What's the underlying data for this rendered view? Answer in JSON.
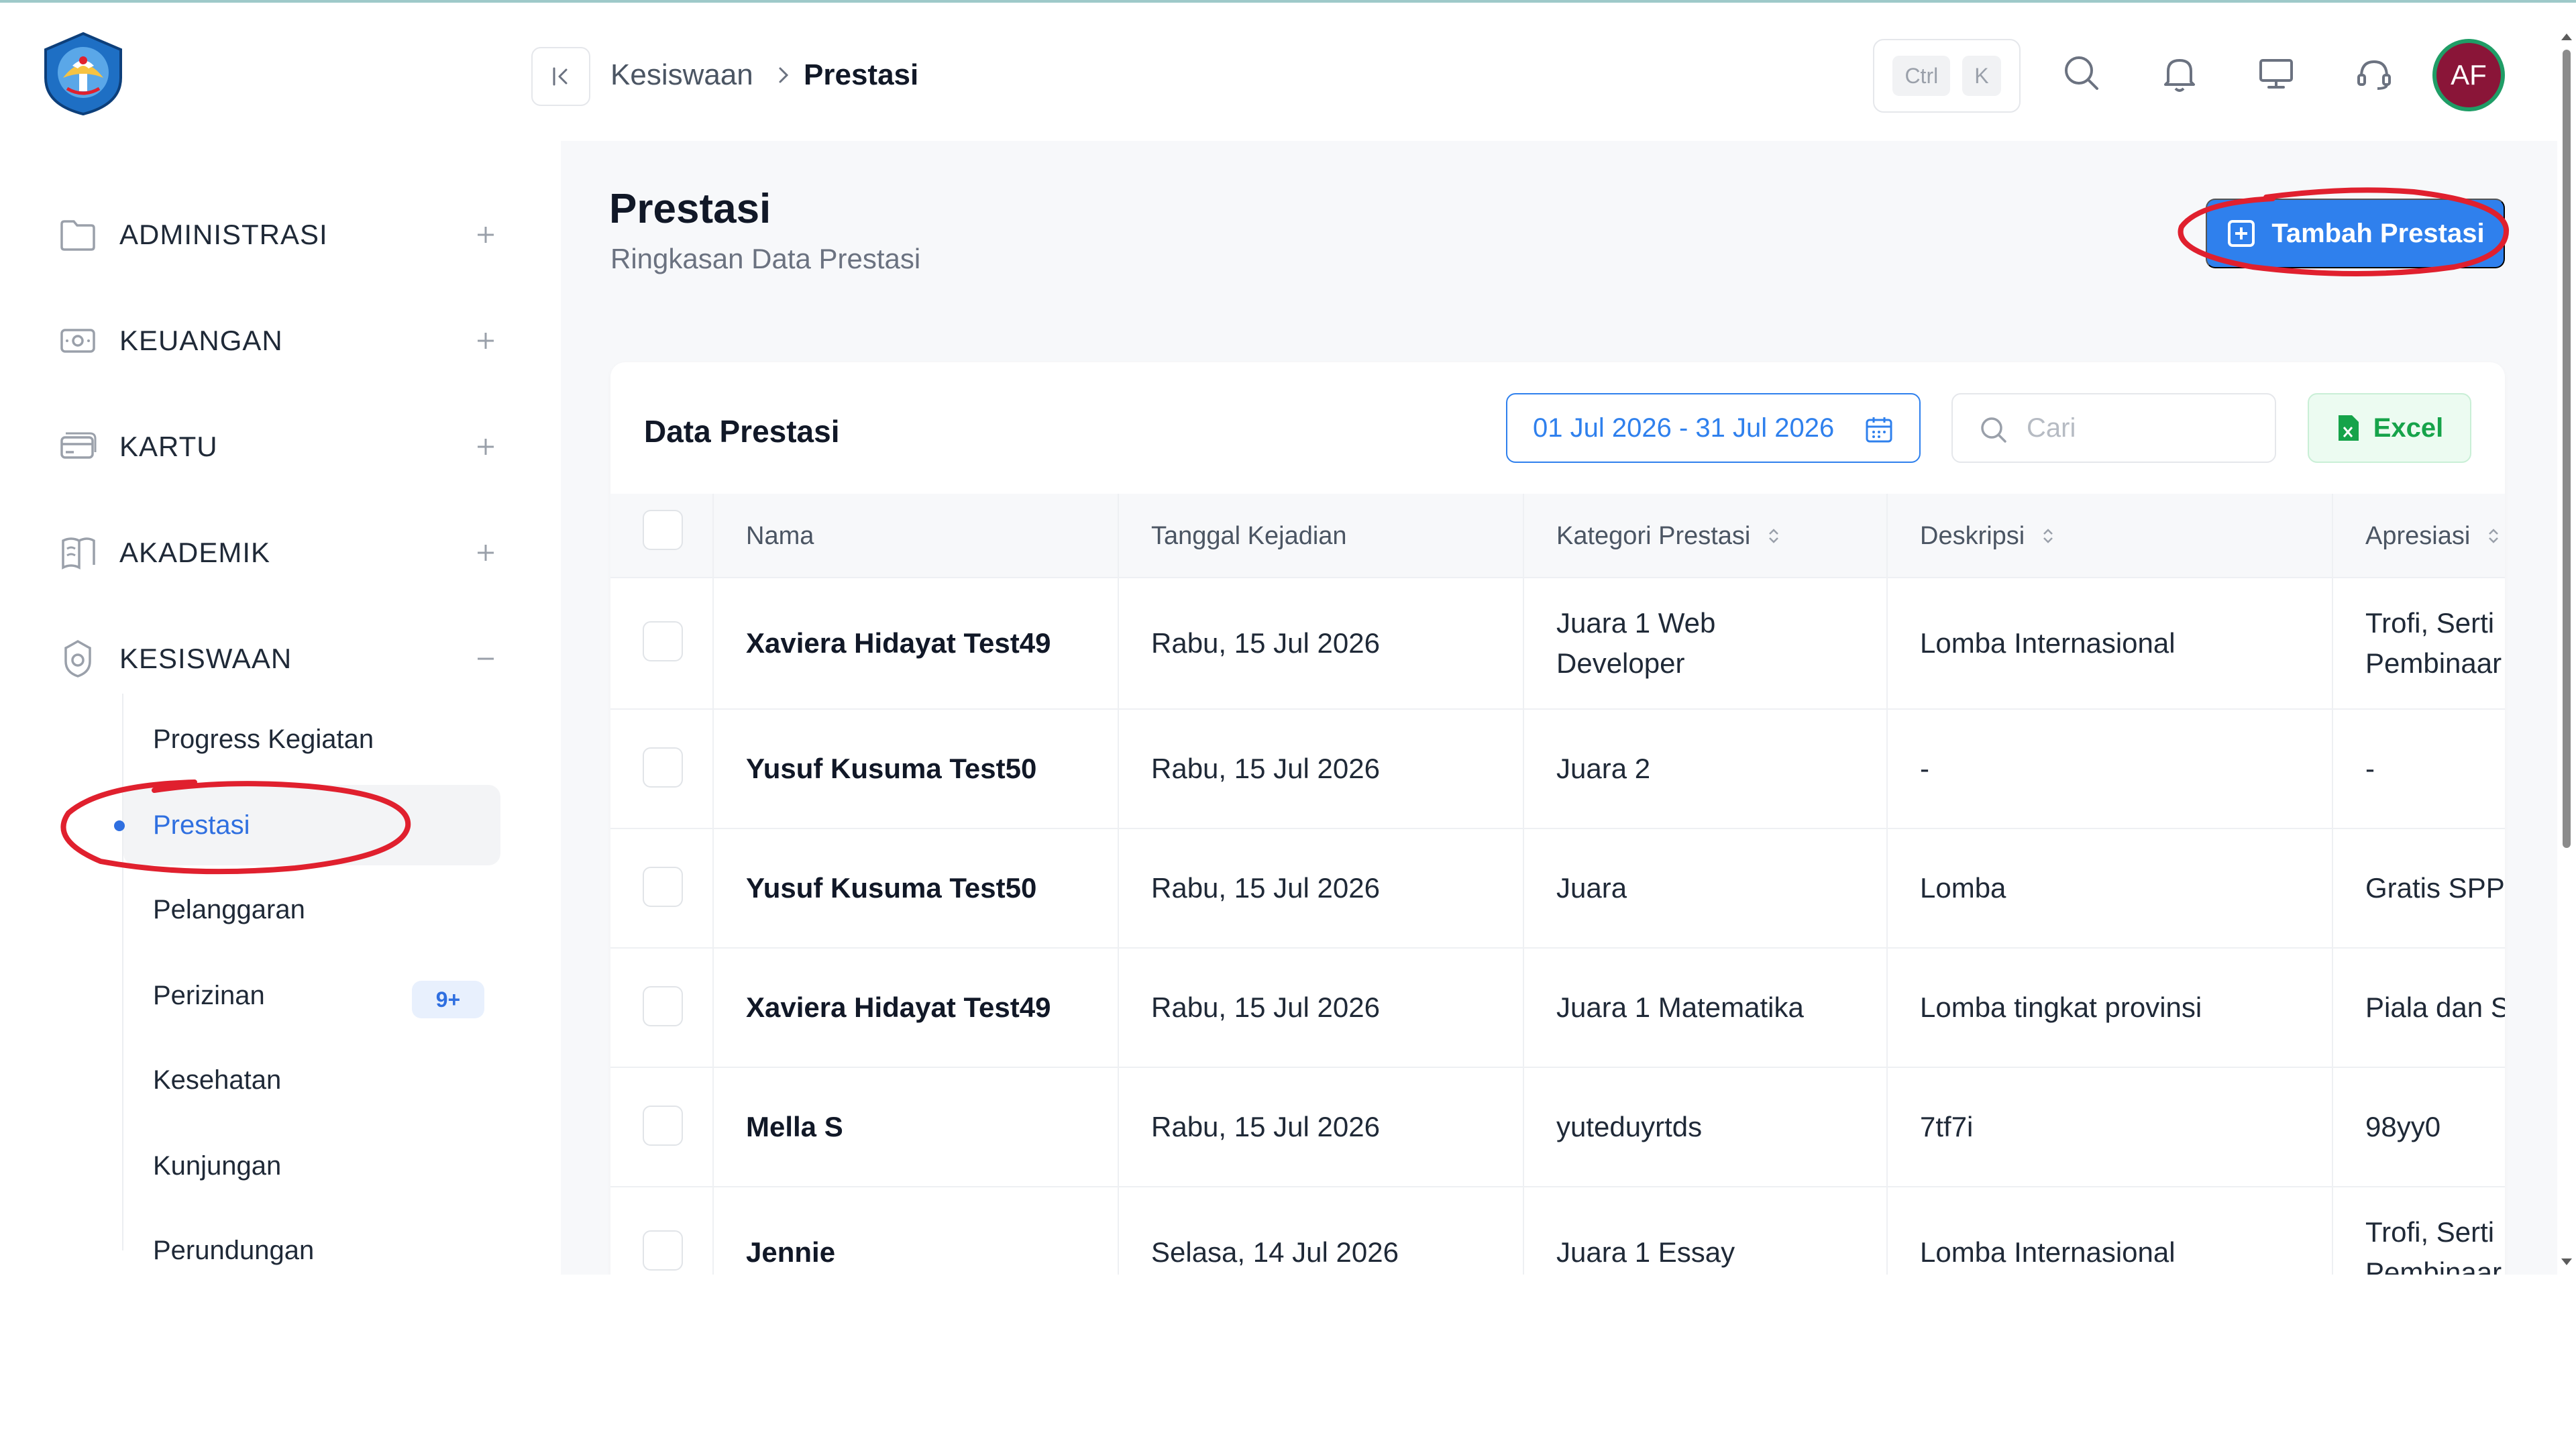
{
  "sidebar": {
    "sections": [
      {
        "label": "ADMINISTRASI",
        "icon": "folder-icon",
        "state": "+"
      },
      {
        "label": "KEUANGAN",
        "icon": "money-icon",
        "state": "+"
      },
      {
        "label": "KARTU",
        "icon": "card-icon",
        "state": "+"
      },
      {
        "label": "AKADEMIK",
        "icon": "book-icon",
        "state": "+"
      },
      {
        "label": "KESISWAAN",
        "icon": "student-badge-icon",
        "state": "−"
      }
    ],
    "sub_items": [
      {
        "label": "Progress Kegiatan",
        "active": false
      },
      {
        "label": "Prestasi",
        "active": true
      },
      {
        "label": "Pelanggaran",
        "active": false
      },
      {
        "label": "Perizinan",
        "active": false,
        "badge": "9+"
      },
      {
        "label": "Kesehatan",
        "active": false
      },
      {
        "label": "Kunjungan",
        "active": false
      },
      {
        "label": "Perundungan",
        "active": false
      }
    ]
  },
  "breadcrumb": {
    "parent": "Kesiswaan",
    "current": "Prestasi"
  },
  "topbar": {
    "shortcut_keys": [
      "Ctrl",
      "K"
    ],
    "avatar_initials": "AF"
  },
  "page": {
    "title": "Prestasi",
    "subtitle": "Ringkasan Data Prestasi",
    "add_button": "Tambah Prestasi"
  },
  "card": {
    "title": "Data Prestasi",
    "date_range": "01 Jul 2026 - 31 Jul 2026",
    "search_placeholder": "Cari",
    "export_button": "Excel"
  },
  "table": {
    "columns": [
      "Nama",
      "Tanggal Kejadian",
      "Kategori Prestasi",
      "Deskripsi",
      "Apresiasi"
    ],
    "rows": [
      {
        "nama": "Xaviera Hidayat Test49",
        "tanggal": "Rabu, 15 Jul 2026",
        "kategori": "Juara 1 Web Developer",
        "deskripsi": "Lomba Internasional",
        "apresiasi": "Trofi, Serti Pembinaar"
      },
      {
        "nama": "Yusuf Kusuma Test50",
        "tanggal": "Rabu, 15 Jul 2026",
        "kategori": "Juara 2",
        "deskripsi": "-",
        "apresiasi": "-"
      },
      {
        "nama": "Yusuf Kusuma Test50",
        "tanggal": "Rabu, 15 Jul 2026",
        "kategori": "Juara",
        "deskripsi": "Lomba",
        "apresiasi": "Gratis SPP"
      },
      {
        "nama": "Xaviera Hidayat Test49",
        "tanggal": "Rabu, 15 Jul 2026",
        "kategori": "Juara 1 Matematika",
        "deskripsi": "Lomba tingkat provinsi",
        "apresiasi": "Piala dan S"
      },
      {
        "nama": "Mella S",
        "tanggal": "Rabu, 15 Jul 2026",
        "kategori": "yuteduyrtds",
        "deskripsi": "7tf7i",
        "apresiasi": "98yy0"
      },
      {
        "nama": "Jennie",
        "tanggal": "Selasa, 14 Jul 2026",
        "kategori": "Juara 1 Essay",
        "deskripsi": "Lomba Internasional",
        "apresiasi": "Trofi, Serti Pembinaar"
      }
    ]
  },
  "colors": {
    "primary": "#2f80ed",
    "active_text": "#2f6fe0",
    "annotation": "#e0202e",
    "excel_green": "#16a34a",
    "avatar_bg": "#8a1538",
    "avatar_ring": "#1f9d66"
  }
}
